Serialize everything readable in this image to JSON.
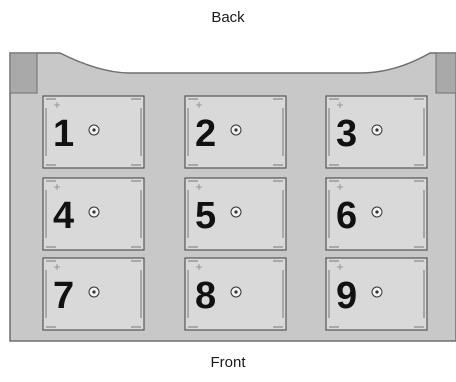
{
  "labels": {
    "back": "Back",
    "front": "Front"
  },
  "slots": [
    "1",
    "2",
    "3",
    "4",
    "5",
    "6",
    "7",
    "8",
    "9"
  ],
  "colors": {
    "tray_fill": "#c8c8c8",
    "tray_stroke": "#6e6e6e",
    "corner_fill": "#a9a9a9",
    "slot_fill": "#d9d9d9",
    "slot_stroke": "#555555",
    "number": "#111111"
  }
}
